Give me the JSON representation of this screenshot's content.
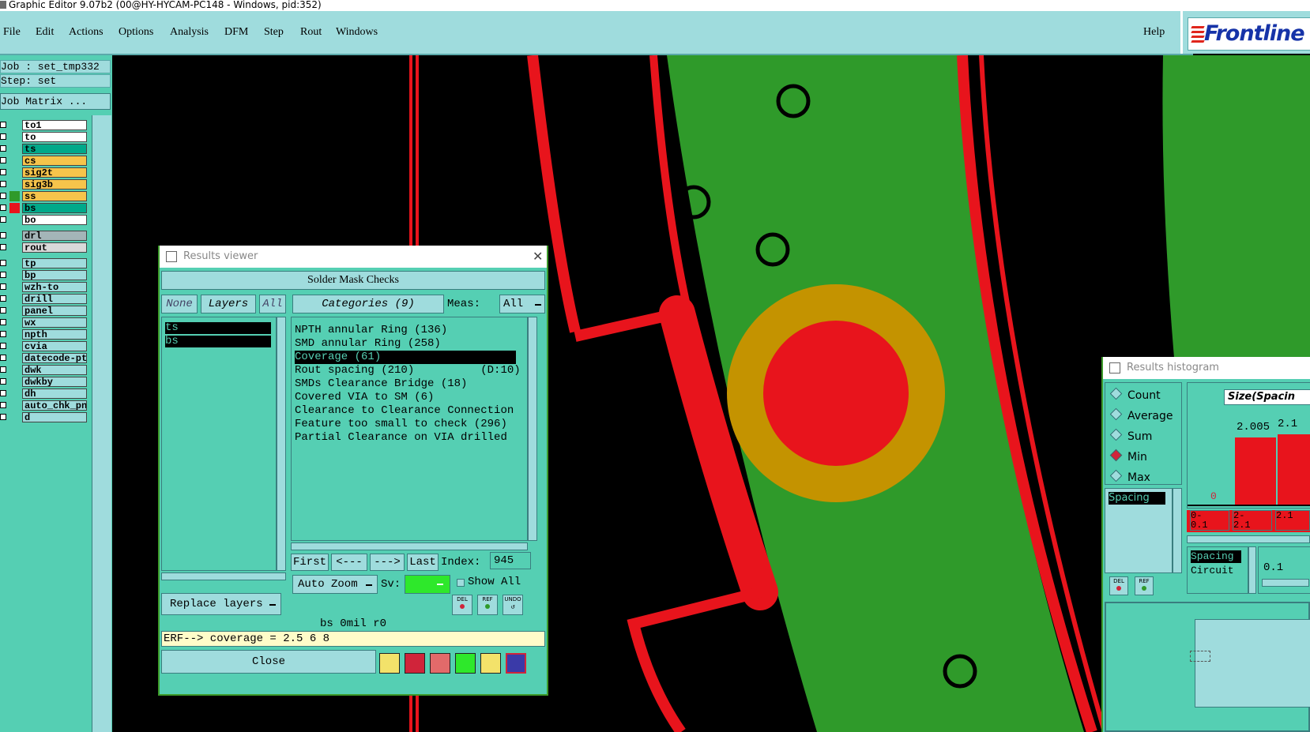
{
  "window": {
    "title": "Graphic Editor 9.07b2 (00@HY-HYCAM-PC148 - Windows, pid:352)"
  },
  "menu": {
    "items": [
      "File",
      "Edit",
      "Actions",
      "Options",
      "Analysis",
      "DFM",
      "Step",
      "Rout",
      "Windows"
    ],
    "help": "Help"
  },
  "logo": {
    "text": "Frontline"
  },
  "job": {
    "job_line": "Job : set_tmp332",
    "step_line": "Step: set",
    "matrix_button": "Job Matrix ..."
  },
  "layers": [
    {
      "name": "to1",
      "color": "#ffffff",
      "swatch": ""
    },
    {
      "name": "to",
      "color": "#ffffff",
      "swatch": ""
    },
    {
      "name": "ts",
      "color": "#00a98a",
      "swatch": ""
    },
    {
      "name": "cs",
      "color": "#f6c44b",
      "swatch": ""
    },
    {
      "name": "sig2t",
      "color": "#f6c44b",
      "swatch": ""
    },
    {
      "name": "sig3b",
      "color": "#f6c44b",
      "swatch": ""
    },
    {
      "name": "ss",
      "color": "#f6c44b",
      "swatch": "#2f9a2a"
    },
    {
      "name": "bs",
      "color": "#00a98a",
      "swatch": "#e8141c"
    },
    {
      "name": "bo",
      "color": "#ffffff",
      "swatch": ""
    },
    {
      "name": "drl",
      "color": "#a4b5b8",
      "swatch": ""
    },
    {
      "name": "rout",
      "color": "#d9d9d9",
      "swatch": ""
    },
    {
      "name": "tp",
      "color": "#9fdcdd",
      "swatch": ""
    },
    {
      "name": "bp",
      "color": "#9fdcdd",
      "swatch": ""
    },
    {
      "name": "wzh-to",
      "color": "#9fdcdd",
      "swatch": ""
    },
    {
      "name": "drill",
      "color": "#9fdcdd",
      "swatch": ""
    },
    {
      "name": "panel",
      "color": "#9fdcdd",
      "swatch": ""
    },
    {
      "name": "wx",
      "color": "#9fdcdd",
      "swatch": ""
    },
    {
      "name": "npth",
      "color": "#9fdcdd",
      "swatch": ""
    },
    {
      "name": "cvia",
      "color": "#9fdcdd",
      "swatch": ""
    },
    {
      "name": "datecode-pte",
      "color": "#9fdcdd",
      "swatch": ""
    },
    {
      "name": "dwk",
      "color": "#9fdcdd",
      "swatch": ""
    },
    {
      "name": "dwkby",
      "color": "#9fdcdd",
      "swatch": ""
    },
    {
      "name": "dh",
      "color": "#9fdcdd",
      "swatch": ""
    },
    {
      "name": "auto_chk_pn",
      "color": "#9fdcdd",
      "swatch": ""
    },
    {
      "name": "d",
      "color": "#9fdcdd",
      "swatch": ""
    }
  ],
  "results_viewer": {
    "title": "Results viewer",
    "header": "Solder Mask Checks",
    "none_btn": "None",
    "layers_btn": "Layers",
    "all_btn": "All",
    "categories_btn": "Categories (9)",
    "meas_label": "Meas:",
    "meas_value": "All",
    "selected_layers": [
      "ts",
      "bs"
    ],
    "categories": [
      "NPTH annular Ring (136)",
      "SMD annular Ring (258)",
      "Coverage (61)",
      "Rout spacing (210)          (D:10)",
      "SMDs Clearance Bridge (18)",
      "Covered VIA to SM (6)",
      "Clearance to Clearance Connection",
      "Feature too small to check (296)",
      "Partial Clearance on VIA drilled"
    ],
    "selected_category_index": 2,
    "nav": {
      "first": "First",
      "prev": "<---",
      "next": "--->",
      "last": "Last",
      "index_label": "Index:",
      "index_value": "945"
    },
    "auto_zoom": "Auto Zoom",
    "sv_label": "Sv:",
    "show_all": "Show All",
    "replace_layers": "Replace layers",
    "icons": [
      "DEL",
      "REF",
      "UNDO"
    ],
    "status": "bs  0mil  r0",
    "erf": "ERF--> coverage = 2.5 6 8",
    "close": "Close"
  },
  "histogram": {
    "title": "Results histogram",
    "options": [
      "Count",
      "Average",
      "Sum",
      "Min",
      "Max"
    ],
    "selected_option": "Min",
    "size_label": "Size(Spacin",
    "list_item": "Spacing",
    "values": [
      "0",
      "2.005",
      "2.1"
    ],
    "ranges": [
      "0-\n0.1",
      "2-\n2.1",
      "2.1"
    ],
    "legend": [
      "Spacing",
      "Circuit"
    ],
    "slider_value": "0.1",
    "icons": [
      "DEL",
      "REF"
    ]
  }
}
